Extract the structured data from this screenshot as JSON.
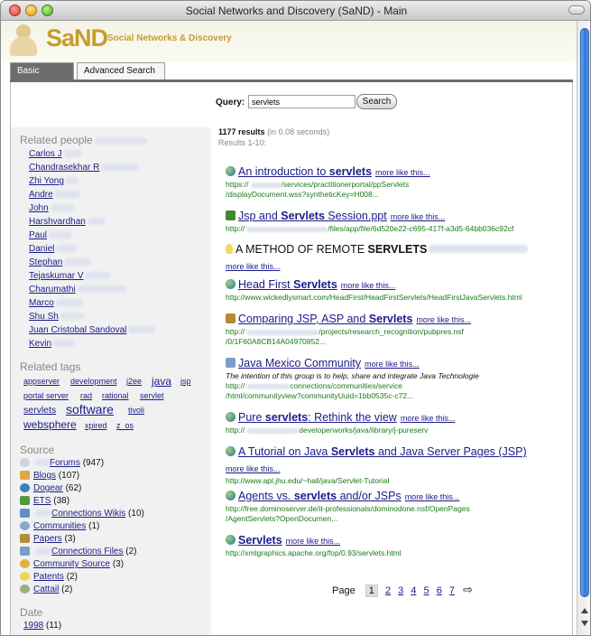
{
  "window": {
    "title": "Social Networks and Discovery (SaND) - Main"
  },
  "header": {
    "logo": "SaND",
    "subtitle": "Social Networks & Discovery"
  },
  "tabs": [
    {
      "label": "Basic Search"
    },
    {
      "label": "Advanced Search"
    }
  ],
  "search": {
    "label": "Query:",
    "value": "servlets",
    "button": "Search"
  },
  "results_info": {
    "count": "1177 results",
    "time": "(in 0.08 seconds)",
    "range": "Results 1-10:"
  },
  "sidebar": {
    "people_heading": "Related people",
    "people": [
      "Carlos J",
      "Chandrasekhar R",
      "Zhi Yong",
      "Andre",
      "John",
      "Harshvardhan",
      "Paul",
      "Daniel",
      "Stephan",
      "Tejaskumar V",
      "Charumathi",
      "Marco",
      "Shu Sh",
      "Juan Cristobal Sandoval",
      "Kevin"
    ],
    "tags_heading": "Related tags",
    "tags": [
      "appserver",
      "development",
      "j2ee",
      "java",
      "jsp",
      "portal server",
      "rad",
      "rational",
      "servlet",
      "servlets",
      "software",
      "tivoli",
      "websphere",
      "xpired",
      "z_os"
    ],
    "source_heading": "Source",
    "sources": [
      {
        "name": "Forums",
        "count": "(947)"
      },
      {
        "name": "Blogs",
        "count": "(107)"
      },
      {
        "name": "Dogear",
        "count": "(62)"
      },
      {
        "name": "ETS",
        "count": "(38)"
      },
      {
        "name": "Connections Wikis",
        "count": "(10)"
      },
      {
        "name": "Communities",
        "count": "(1)"
      },
      {
        "name": "Papers",
        "count": "(3)"
      },
      {
        "name": "Connections Files",
        "count": "(2)"
      },
      {
        "name": "Community Source",
        "count": "(3)"
      },
      {
        "name": "Patents",
        "count": "(2)"
      },
      {
        "name": "Cattail",
        "count": "(2)"
      }
    ],
    "date_heading": "Date",
    "dates": [
      {
        "year": "1998",
        "count": "(11)"
      }
    ]
  },
  "results": [
    {
      "title_pre": "An introduction to ",
      "title_em": "servlets",
      "title_post": "",
      "more": "more like this...",
      "url1": "https://",
      "url1b": "/services/practitionerportal/ppServlets",
      "url2": "/displayDocument.wss?syntheticKey=H008...",
      "snippet": ""
    },
    {
      "title_pre": "Jsp and ",
      "title_em": "Servlets",
      "title_post": " Session.ppt",
      "more": "more like this...",
      "url1": "http://",
      "url1b": "/files/app/file/6d520e22-c695-417f-a3d5-64bb036c92cf",
      "url2": "",
      "snippet": ""
    },
    {
      "title_pre": "A METHOD OF REMOTE ",
      "title_em": "SERVLETS",
      "title_post": "",
      "more": "more like this...",
      "url1": "",
      "url1b": "",
      "url2": "",
      "snippet": ""
    },
    {
      "title_pre": "Head First ",
      "title_em": "Servlets",
      "title_post": "",
      "more": "more like this...",
      "url1": "http://www.wickedlysmart.com/HeadFirst/HeadFirstServlets/HeadFirstJavaServlets.html",
      "url1b": "",
      "url2": "",
      "snippet": ""
    },
    {
      "title_pre": "Comparing JSP, ASP and ",
      "title_em": "Servlets",
      "title_post": "",
      "more": "more like this...",
      "url1": "http://",
      "url1b": "/projects/research_recognition/pubpres.nsf",
      "url2": "/0/1F60A8CB14A04970852...",
      "snippet": ""
    },
    {
      "title_pre": "Java Mexico Community",
      "title_em": "",
      "title_post": "",
      "more": "more like this...",
      "url1": "http://",
      "url1b": "connections/communities/service",
      "url2": "/html/communityview?communityUuid=1bb0535c-c72...",
      "snippet": "The intention of this group is to help, share and integrate Java Technologie"
    },
    {
      "title_pre": "Pure ",
      "title_em": "servlets",
      "title_post": ": Rethink the view",
      "more": "more like this...",
      "url1": "http://",
      "url1b": "developerworks/java/library/j-pureserv",
      "url2": "",
      "snippet": ""
    },
    {
      "title_pre": "A Tutorial on Java ",
      "title_em": "Servlets",
      "title_post": " and Java Server Pages (JSP)",
      "more": "more like this...",
      "url1": "http://www.apl.jhu.edu/~hall/java/Servlet-Tutorial",
      "url1b": "",
      "url2": "",
      "snippet": ""
    },
    {
      "title_pre": "Agents vs. ",
      "title_em": "servlets",
      "title_post": " and/or JSPs",
      "more": "more like this...",
      "url1": "http://free.dominoserver.de/it-professionals/dominodone.nsf/OpenPages",
      "url1b": "",
      "url2": "/AgentServlets?OpenDocumen...",
      "snippet": ""
    },
    {
      "title_pre": "",
      "title_em": "Servlets",
      "title_post": "",
      "more": "more like this...",
      "url1": "http://xmlgraphics.apache.org/fop/0.93/servlets.html",
      "url1b": "",
      "url2": "",
      "snippet": ""
    }
  ],
  "pager": {
    "label": "Page",
    "current": "1",
    "pages": [
      "2",
      "3",
      "4",
      "5",
      "6",
      "7"
    ],
    "next_icon": "arrow-right-icon"
  },
  "colors": {
    "link": "#1b1b8a",
    "url": "#1a7a1a",
    "brand": "#c89b30",
    "tab_active": "#6d6d6d"
  }
}
